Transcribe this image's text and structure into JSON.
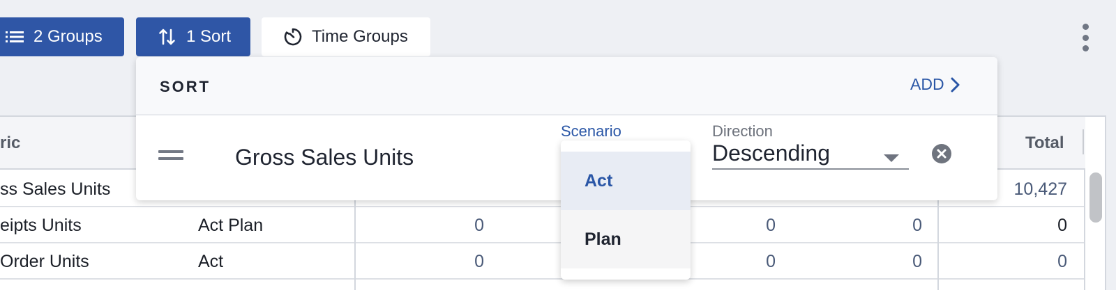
{
  "toolbar": {
    "groups_label": "2 Groups",
    "sort_label": "1 Sort",
    "time_groups_label": "Time Groups"
  },
  "grid": {
    "header_metric": "ric",
    "header_total": "Total",
    "rows": [
      {
        "metric": "ss Sales Units",
        "scenario": "",
        "v1": "",
        "v2": "",
        "v3": "",
        "total": "10,427"
      },
      {
        "metric": "eipts Units",
        "scenario": "Act Plan",
        "v1": "0",
        "v2": "0",
        "v3": "0",
        "total": "0"
      },
      {
        "metric": "Order Units",
        "scenario": "Act",
        "v1": "0",
        "v2": "0",
        "v3": "0",
        "total": "0"
      }
    ]
  },
  "sort_panel": {
    "title": "SORT",
    "add_label": "ADD",
    "rule": {
      "metric": "Gross Sales Units",
      "scenario_label": "Scenario",
      "direction_label": "Direction",
      "direction_value": "Descending"
    },
    "scenario_options": [
      "Act",
      "Plan"
    ],
    "selected_scenario": "Act"
  },
  "colors": {
    "primary": "#2f56a6",
    "accent_text": "#2a56a6",
    "background": "#eef0f4"
  }
}
